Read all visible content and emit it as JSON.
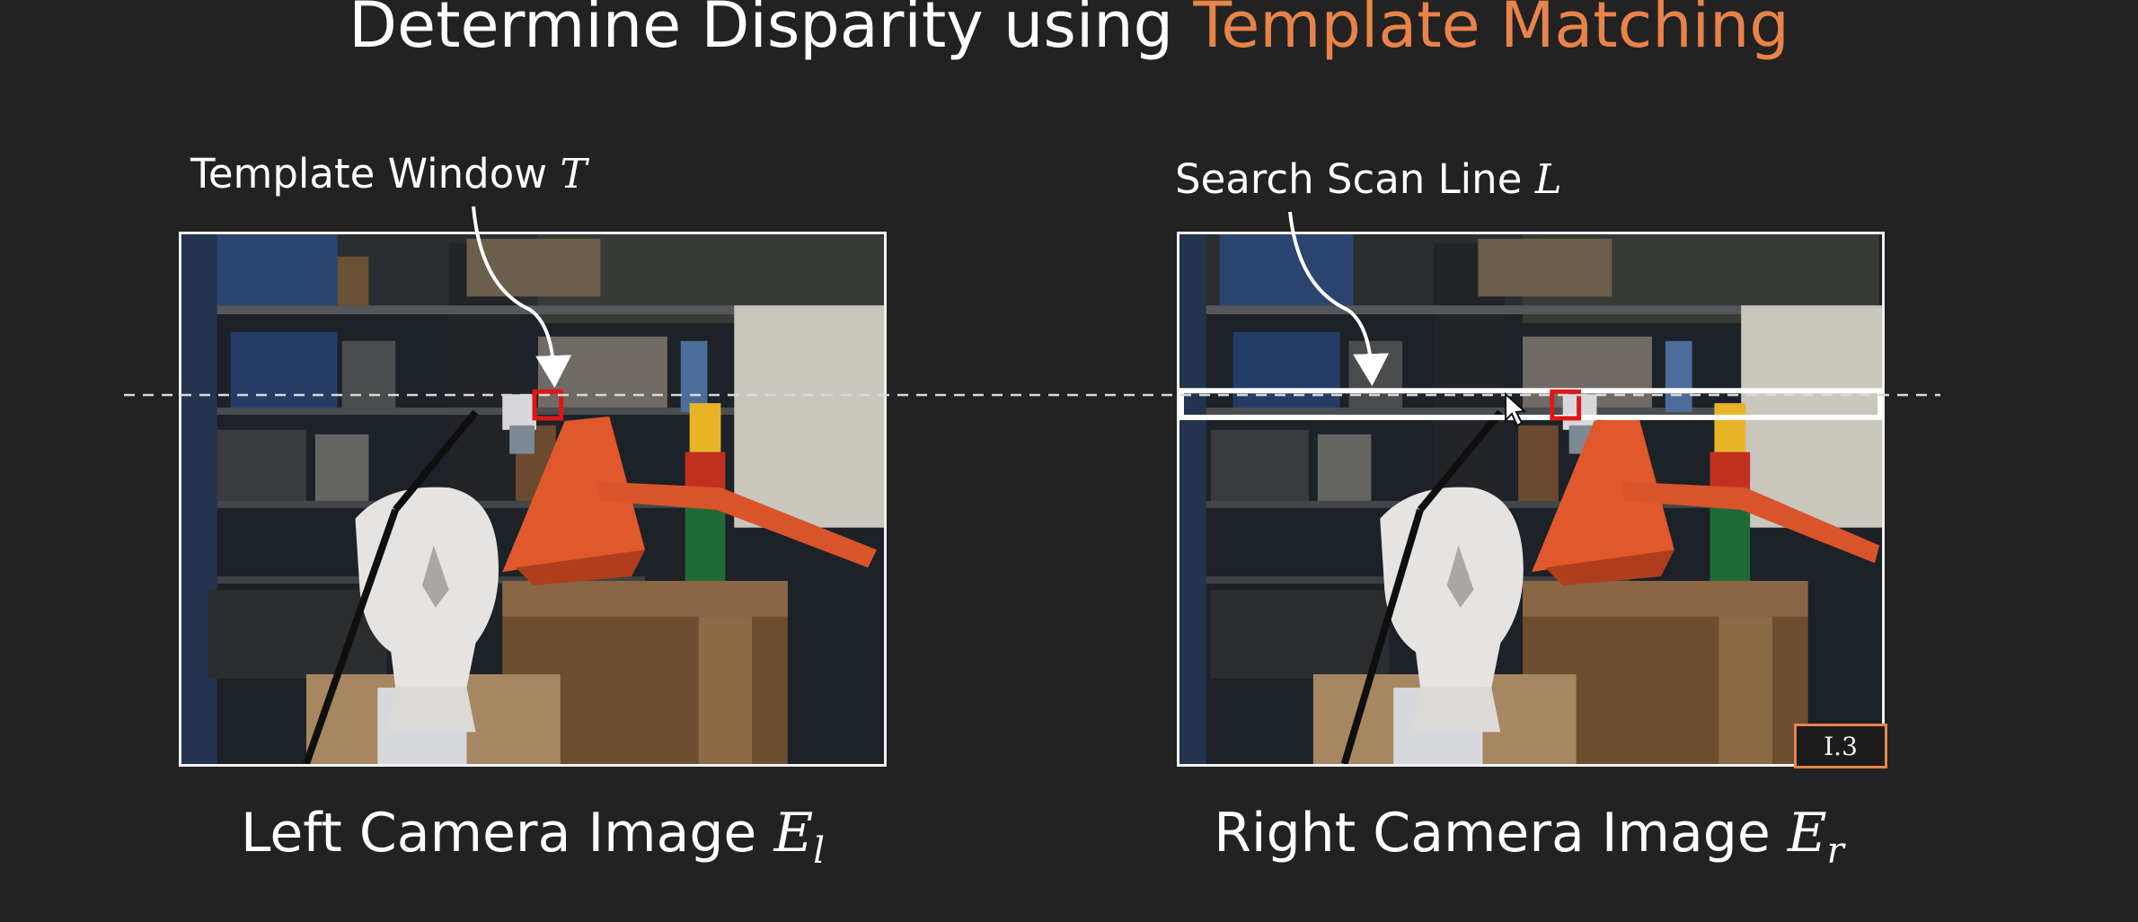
{
  "title": {
    "prefix": "Determine Disparity using",
    "accent": "Template Matching",
    "accent_color": "#e8834a"
  },
  "left_panel": {
    "annotation_text": "Template Window",
    "annotation_symbol": "T",
    "caption_text": "Left Camera Image",
    "caption_symbol": "E",
    "caption_subscript": "l"
  },
  "right_panel": {
    "annotation_text": "Search Scan Line",
    "annotation_symbol": "L",
    "caption_text": "Right Camera Image",
    "caption_symbol": "E",
    "caption_subscript": "r"
  },
  "slide_number": "I.3",
  "colors": {
    "background": "#232222",
    "template_box": "#e01616",
    "scan_band": "#ffffff",
    "dashed_line": "#d9d9d9"
  },
  "icons": {
    "annotation_arrows": "curved-arrow-icon",
    "pointer": "mouse-cursor-icon"
  }
}
